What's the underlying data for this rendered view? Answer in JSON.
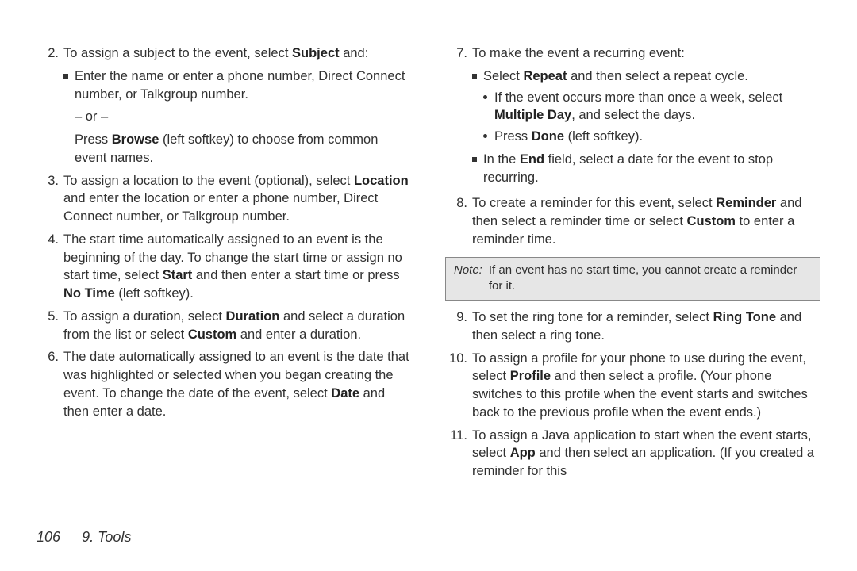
{
  "footer": {
    "page": "106",
    "section": "9. Tools"
  },
  "left": {
    "n2": "2.",
    "n2_text": "To assign a subject to the event, select ",
    "n2_bold": "Subject",
    "n2_tail": " and:",
    "n2_sub1": "Enter the name or enter a phone number, Direct Connect number, or Talkgroup number.",
    "or": "– or –",
    "n2_press_a": "Press ",
    "n2_press_b": "Browse",
    "n2_press_c": " (left softkey) to choose from common event names.",
    "n3": "3.",
    "n3_a": "To assign a location to the event (optional), select ",
    "n3_b": "Location",
    "n3_c": " and enter the location or enter a phone number, Direct Connect number, or Talkgroup number.",
    "n4": "4.",
    "n4_a": "The start time automatically assigned to an event is the beginning of the day. To change the start time or assign no start time, select ",
    "n4_b": "Start",
    "n4_c": " and then enter a start time or press ",
    "n4_d": "No Time",
    "n4_e": " (left softkey).",
    "n5": "5.",
    "n5_a": "To assign a duration, select ",
    "n5_b": "Duration",
    "n5_c": " and select a duration from the list or select ",
    "n5_d": "Custom",
    "n5_e": " and enter a duration.",
    "n6": "6.",
    "n6_a": "The date automatically assigned to an event is the date that was highlighted or selected when you began creating the event. To change the date of the event, select ",
    "n6_b": "Date",
    "n6_c": " and then enter a date."
  },
  "right": {
    "n7": "7.",
    "n7_text": "To make the event a recurring event:",
    "n7_s1_a": "Select ",
    "n7_s1_b": "Repeat",
    "n7_s1_c": " and then select a repeat cycle.",
    "n7_d1_a": "If the event occurs more than once a week, select ",
    "n7_d1_b": "Multiple Day",
    "n7_d1_c": ", and select the days.",
    "n7_d2_a": "Press ",
    "n7_d2_b": "Done",
    "n7_d2_c": " (left softkey).",
    "n7_s2_a": "In the ",
    "n7_s2_b": "End",
    "n7_s2_c": " field, select a date for the event to stop recurring.",
    "n8": "8.",
    "n8_a": "To create a reminder for this event, select ",
    "n8_b": "Reminder",
    "n8_c": " and then select a reminder time or select ",
    "n8_d": "Custom",
    "n8_e": " to enter a reminder time.",
    "note_label": "Note:",
    "note_body": "If an event has no start time, you cannot create a reminder for it.",
    "n9": "9.",
    "n9_a": "To set the ring tone for a reminder, select ",
    "n9_b": "Ring Tone",
    "n9_c": " and then select a ring tone.",
    "n10": "10.",
    "n10_a": "To assign a profile for your phone to use during the event, select ",
    "n10_b": "Profile",
    "n10_c": " and then select a profile. (Your phone switches to this profile when the event starts and switches back to the previous profile when the event ends.)",
    "n11": "11.",
    "n11_a": "To assign a Java application to start when the event starts, select ",
    "n11_b": "App",
    "n11_c": " and then select an application. (If you created a reminder for this"
  }
}
